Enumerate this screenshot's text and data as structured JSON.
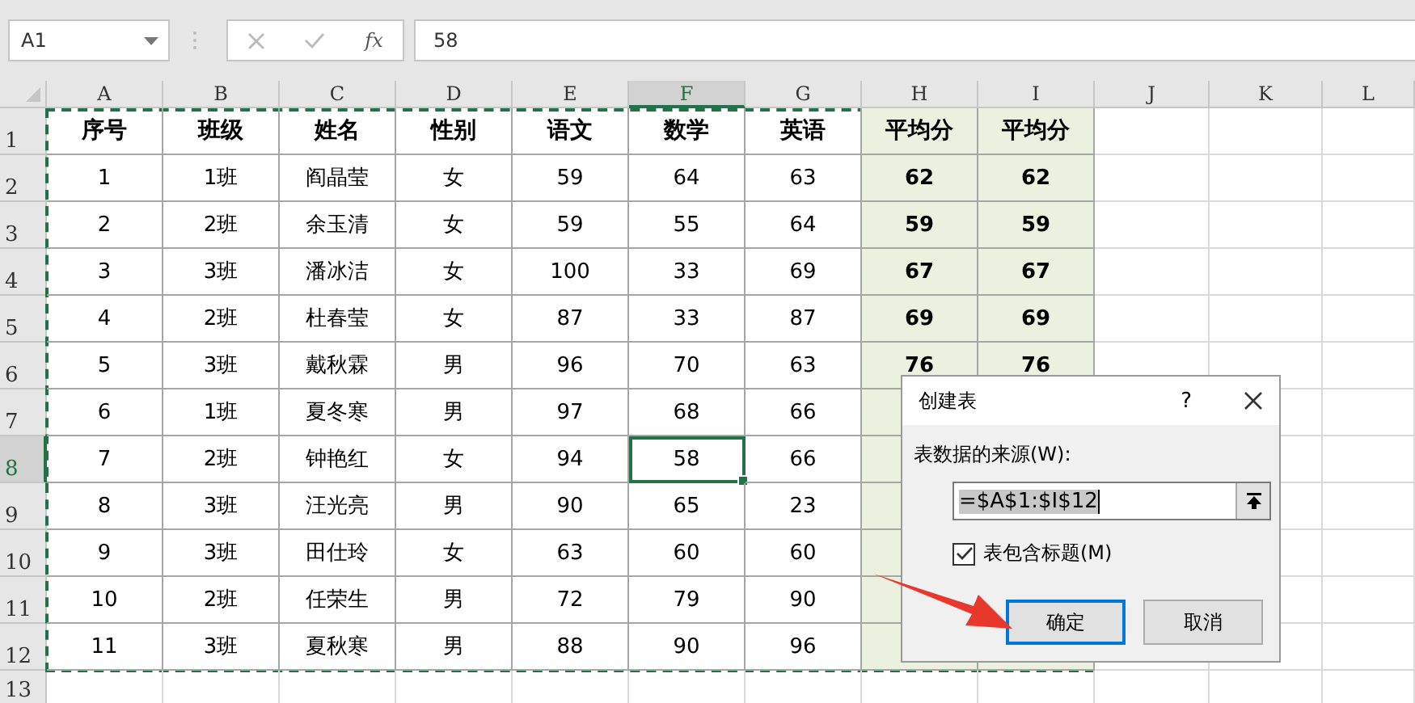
{
  "name_box": {
    "value": "A1"
  },
  "formula_bar": {
    "function_label": "fx",
    "value": "58"
  },
  "columns": [
    {
      "label": "A",
      "selected": false,
      "highlighted": false
    },
    {
      "label": "B",
      "selected": false,
      "highlighted": false
    },
    {
      "label": "C",
      "selected": false,
      "highlighted": false
    },
    {
      "label": "D",
      "selected": false,
      "highlighted": false
    },
    {
      "label": "E",
      "selected": false,
      "highlighted": false
    },
    {
      "label": "F",
      "selected": true,
      "highlighted": false
    },
    {
      "label": "G",
      "selected": false,
      "highlighted": false
    },
    {
      "label": "H",
      "selected": false,
      "highlighted": true
    },
    {
      "label": "I",
      "selected": false,
      "highlighted": true
    },
    {
      "label": "J",
      "selected": false,
      "highlighted": false
    },
    {
      "label": "K",
      "selected": false,
      "highlighted": false
    },
    {
      "label": "L",
      "selected": false,
      "highlighted": false
    }
  ],
  "rows": [
    {
      "number": "1",
      "selected": false,
      "kind": "header",
      "cells": [
        {
          "text": "序号",
          "selected": false
        },
        {
          "text": "班级",
          "selected": false
        },
        {
          "text": "姓名",
          "selected": false
        },
        {
          "text": "性别",
          "selected": false
        },
        {
          "text": "语文",
          "selected": false
        },
        {
          "text": "数学",
          "selected": false
        },
        {
          "text": "英语",
          "selected": false
        },
        {
          "text": "平均分",
          "selected": false
        },
        {
          "text": "平均分",
          "selected": false
        }
      ]
    },
    {
      "number": "2",
      "selected": false,
      "kind": "data",
      "cells": [
        {
          "text": "1",
          "selected": false
        },
        {
          "text": "1班",
          "selected": false
        },
        {
          "text": "阎晶莹",
          "selected": false
        },
        {
          "text": "女",
          "selected": false
        },
        {
          "text": "59",
          "selected": false
        },
        {
          "text": "64",
          "selected": false
        },
        {
          "text": "63",
          "selected": false
        },
        {
          "text": "62",
          "selected": false
        },
        {
          "text": "62",
          "selected": false
        }
      ]
    },
    {
      "number": "3",
      "selected": false,
      "kind": "data",
      "cells": [
        {
          "text": "2",
          "selected": false
        },
        {
          "text": "2班",
          "selected": false
        },
        {
          "text": "余玉清",
          "selected": false
        },
        {
          "text": "女",
          "selected": false
        },
        {
          "text": "59",
          "selected": false
        },
        {
          "text": "55",
          "selected": false
        },
        {
          "text": "64",
          "selected": false
        },
        {
          "text": "59",
          "selected": false
        },
        {
          "text": "59",
          "selected": false
        }
      ]
    },
    {
      "number": "4",
      "selected": false,
      "kind": "data",
      "cells": [
        {
          "text": "3",
          "selected": false
        },
        {
          "text": "3班",
          "selected": false
        },
        {
          "text": "潘冰洁",
          "selected": false
        },
        {
          "text": "女",
          "selected": false
        },
        {
          "text": "100",
          "selected": false
        },
        {
          "text": "33",
          "selected": false
        },
        {
          "text": "69",
          "selected": false
        },
        {
          "text": "67",
          "selected": false
        },
        {
          "text": "67",
          "selected": false
        }
      ]
    },
    {
      "number": "5",
      "selected": false,
      "kind": "data",
      "cells": [
        {
          "text": "4",
          "selected": false
        },
        {
          "text": "2班",
          "selected": false
        },
        {
          "text": "杜春莹",
          "selected": false
        },
        {
          "text": "女",
          "selected": false
        },
        {
          "text": "87",
          "selected": false
        },
        {
          "text": "33",
          "selected": false
        },
        {
          "text": "87",
          "selected": false
        },
        {
          "text": "69",
          "selected": false
        },
        {
          "text": "69",
          "selected": false
        }
      ]
    },
    {
      "number": "6",
      "selected": false,
      "kind": "data",
      "cells": [
        {
          "text": "5",
          "selected": false
        },
        {
          "text": "3班",
          "selected": false
        },
        {
          "text": "戴秋霖",
          "selected": false
        },
        {
          "text": "男",
          "selected": false
        },
        {
          "text": "96",
          "selected": false
        },
        {
          "text": "70",
          "selected": false
        },
        {
          "text": "63",
          "selected": false
        },
        {
          "text": "76",
          "selected": false
        },
        {
          "text": "76",
          "selected": false
        }
      ]
    },
    {
      "number": "7",
      "selected": false,
      "kind": "data",
      "cells": [
        {
          "text": "6",
          "selected": false
        },
        {
          "text": "1班",
          "selected": false
        },
        {
          "text": "夏冬寒",
          "selected": false
        },
        {
          "text": "男",
          "selected": false
        },
        {
          "text": "97",
          "selected": false
        },
        {
          "text": "68",
          "selected": false
        },
        {
          "text": "66",
          "selected": false
        }
      ]
    },
    {
      "number": "8",
      "selected": true,
      "kind": "data",
      "cells": [
        {
          "text": "7",
          "selected": false
        },
        {
          "text": "2班",
          "selected": false
        },
        {
          "text": "钟艳红",
          "selected": false
        },
        {
          "text": "女",
          "selected": false
        },
        {
          "text": "94",
          "selected": false
        },
        {
          "text": "58",
          "selected": true
        },
        {
          "text": "66",
          "selected": false
        }
      ]
    },
    {
      "number": "9",
      "selected": false,
      "kind": "data",
      "cells": [
        {
          "text": "8",
          "selected": false
        },
        {
          "text": "3班",
          "selected": false
        },
        {
          "text": "汪光亮",
          "selected": false
        },
        {
          "text": "男",
          "selected": false
        },
        {
          "text": "90",
          "selected": false
        },
        {
          "text": "65",
          "selected": false
        },
        {
          "text": "23",
          "selected": false
        }
      ]
    },
    {
      "number": "10",
      "selected": false,
      "kind": "data",
      "cells": [
        {
          "text": "9",
          "selected": false
        },
        {
          "text": "3班",
          "selected": false
        },
        {
          "text": "田仕玲",
          "selected": false
        },
        {
          "text": "女",
          "selected": false
        },
        {
          "text": "63",
          "selected": false
        },
        {
          "text": "60",
          "selected": false
        },
        {
          "text": "60",
          "selected": false
        }
      ]
    },
    {
      "number": "11",
      "selected": false,
      "kind": "data",
      "cells": [
        {
          "text": "10",
          "selected": false
        },
        {
          "text": "2班",
          "selected": false
        },
        {
          "text": "任荣生",
          "selected": false
        },
        {
          "text": "男",
          "selected": false
        },
        {
          "text": "72",
          "selected": false
        },
        {
          "text": "79",
          "selected": false
        },
        {
          "text": "90",
          "selected": false
        }
      ]
    },
    {
      "number": "12",
      "selected": false,
      "kind": "data",
      "cells": [
        {
          "text": "11",
          "selected": false
        },
        {
          "text": "3班",
          "selected": false
        },
        {
          "text": "夏秋寒",
          "selected": false
        },
        {
          "text": "男",
          "selected": false
        },
        {
          "text": "88",
          "selected": false
        },
        {
          "text": "90",
          "selected": false
        },
        {
          "text": "96",
          "selected": false
        }
      ]
    },
    {
      "number": "13",
      "selected": false,
      "kind": "empty",
      "cells": []
    }
  ],
  "dialog": {
    "title": "创建表",
    "help": "?",
    "source_label": "表数据的来源(W):",
    "range_value": "=$A$1:$I$12",
    "has_headers": {
      "label": "表包含标题(M)",
      "checked": true
    },
    "buttons": [
      {
        "label": "确定",
        "default": true
      },
      {
        "label": "取消",
        "default": false
      }
    ]
  }
}
